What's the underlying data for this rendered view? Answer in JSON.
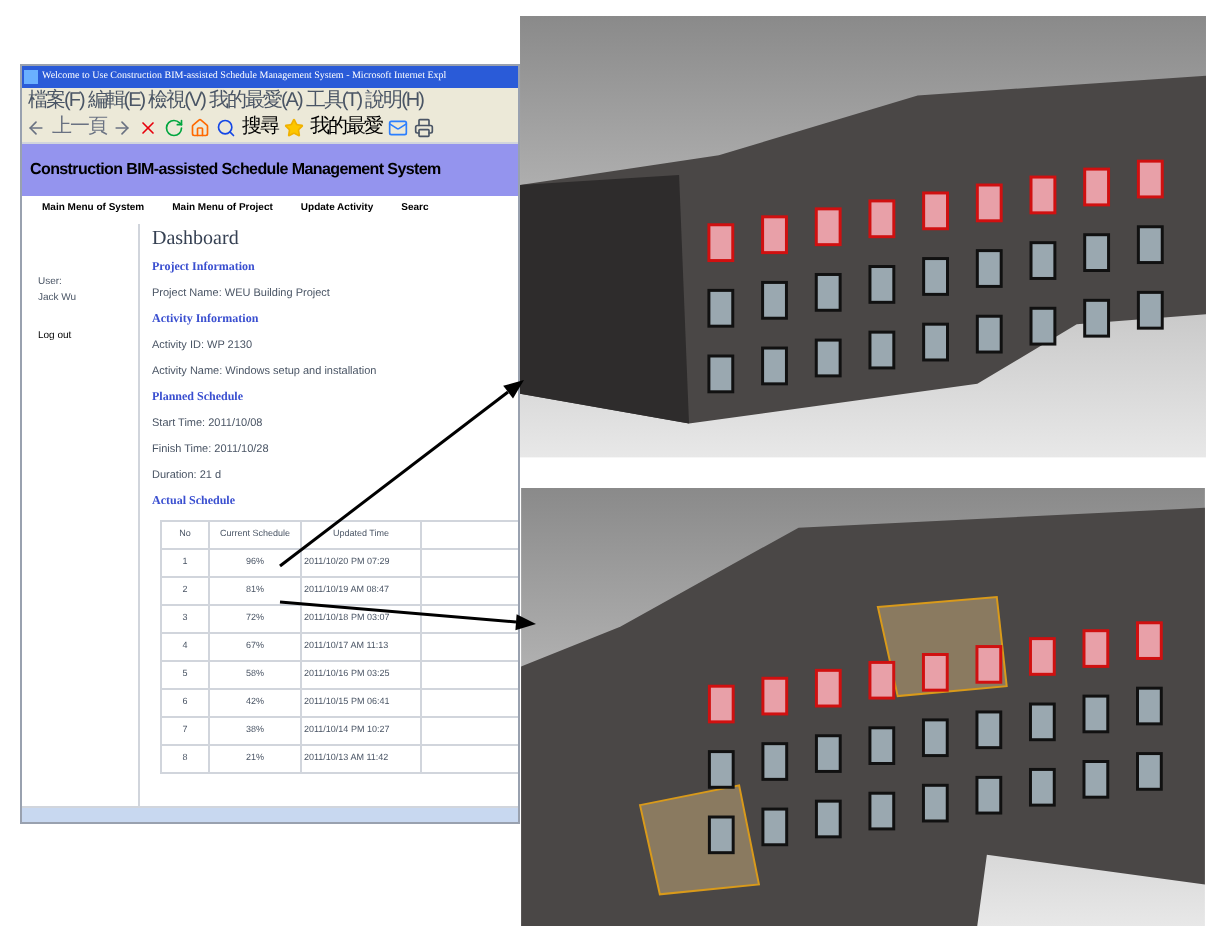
{
  "browser": {
    "title": "Welcome to Use Construction BIM-assisted Schedule Management System - Microsoft Internet Expl",
    "menu": [
      "檔案(F)",
      "編輯(E)",
      "檢視(V)",
      "我的最愛(A)",
      "工具(T)",
      "說明(H)"
    ],
    "toolbar": {
      "back": "上一頁",
      "search": "搜尋",
      "favorites": "我的最愛"
    }
  },
  "site": {
    "title": "Construction BIM-assisted Schedule Management System",
    "nav": [
      "Main Menu of System",
      "Main Menu of Project",
      "Update Activity",
      "Searc"
    ]
  },
  "sidebar": {
    "user_label": "User:",
    "user_name": "Jack Wu",
    "logout": "Log out"
  },
  "dashboard": {
    "heading": "Dashboard",
    "sections": [
      {
        "title": "Project Information",
        "lines": [
          "Project Name: WEU Building Project"
        ]
      },
      {
        "title": "Activity Information",
        "lines": [
          "Activity ID: WP 2130",
          "Activity Name: Windows setup and installation"
        ]
      },
      {
        "title": "Planned Schedule",
        "lines": [
          "Start Time: 2011/10/08",
          "Finish Time: 2011/10/28",
          "Duration: 21 d"
        ]
      },
      {
        "title": "Actual Schedule"
      }
    ]
  },
  "table": {
    "columns": [
      "No",
      "Current Schedule",
      "Updated Time"
    ],
    "rows": [
      [
        "1",
        "96%",
        "2011/10/20 PM 07:29"
      ],
      [
        "2",
        "81%",
        "2011/10/19 AM 08:47"
      ],
      [
        "3",
        "72%",
        "2011/10/18 PM 03:07"
      ],
      [
        "4",
        "67%",
        "2011/10/17 AM 11:13"
      ],
      [
        "5",
        "58%",
        "2011/10/16 PM 03:25"
      ],
      [
        "6",
        "42%",
        "2011/10/15 PM 06:41"
      ],
      [
        "7",
        "38%",
        "2011/10/14 PM 10:27"
      ],
      [
        "8",
        "21%",
        "2011/10/13 AM 11:42"
      ]
    ]
  }
}
